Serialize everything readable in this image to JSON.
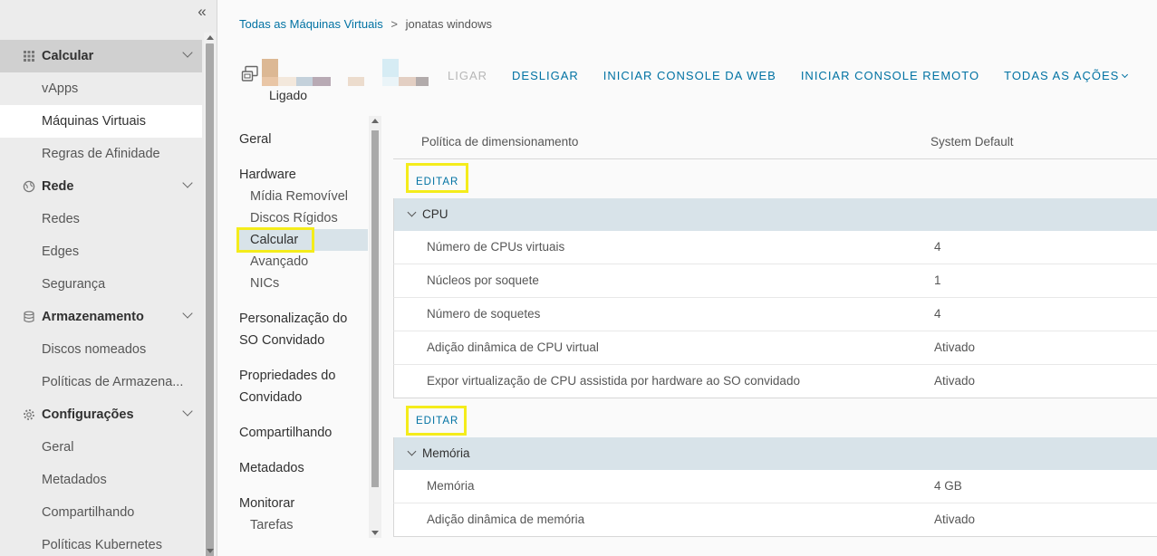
{
  "leftnav": {
    "groups": [
      {
        "label": "Calcular",
        "items": [
          "vApps",
          "Máquinas Virtuais",
          "Regras de Afinidade"
        ]
      },
      {
        "label": "Rede",
        "items": [
          "Redes",
          "Edges",
          "Segurança"
        ]
      },
      {
        "label": "Armazenamento",
        "items": [
          "Discos nomeados",
          "Políticas de Armazena..."
        ]
      },
      {
        "label": "Configurações",
        "items": [
          "Geral",
          "Metadados",
          "Compartilhando",
          "Políticas Kubernetes"
        ]
      }
    ]
  },
  "breadcrumb": {
    "parent": "Todas as Máquinas Virtuais",
    "separator": ">",
    "current": "jonatas windows"
  },
  "vm": {
    "status": "Ligado"
  },
  "actions": {
    "power_on": "LIGAR",
    "power_off": "DESLIGAR",
    "web_console": "INICIAR CONSOLE DA WEB",
    "remote_console": "INICIAR CONSOLE REMOTO",
    "all_actions": "TODAS AS AÇÕES"
  },
  "innernav": {
    "geral": "Geral",
    "hardware": "Hardware",
    "hardware_items": [
      "Mídia Removível",
      "Discos Rígidos",
      "Calcular",
      "Avançado",
      "NICs"
    ],
    "personalizacao_1": "Personalização do",
    "personalizacao_2": "SO Convidado",
    "propriedades_1": "Propriedades do",
    "propriedades_2": "Convidado",
    "compartilhando": "Compartilhando",
    "metadados": "Metadados",
    "monitorar": "Monitorar",
    "monitorar_items": [
      "Tarefas"
    ]
  },
  "content": {
    "sizing": {
      "label": "Política de dimensionamento",
      "value": "System Default"
    },
    "edit_label": "EDITAR",
    "cpu": {
      "title": "CPU",
      "rows": [
        {
          "label": "Número de CPUs virtuais",
          "value": "4"
        },
        {
          "label": "Núcleos por soquete",
          "value": "1"
        },
        {
          "label": "Número de soquetes",
          "value": "4"
        },
        {
          "label": "Adição dinâmica de CPU virtual",
          "value": "Ativado"
        },
        {
          "label": "Expor virtualização de CPU assistida por hardware ao SO convidado",
          "value": "Ativado"
        }
      ]
    },
    "memory": {
      "title": "Memória",
      "rows": [
        {
          "label": "Memória",
          "value": "4 GB"
        },
        {
          "label": "Adição dinâmica de memória",
          "value": "Ativado"
        }
      ]
    }
  },
  "colors": {
    "link": "#0072a3",
    "highlight": "#f4ec1b",
    "section_bg": "#d8e3e9",
    "selected_bg": "#ffffff"
  },
  "icons": [
    "collapse-double-chevron-icon",
    "grid-icon",
    "globe-icon",
    "database-icon",
    "gear-icon",
    "vm-icon",
    "chevron-down-icon"
  ]
}
